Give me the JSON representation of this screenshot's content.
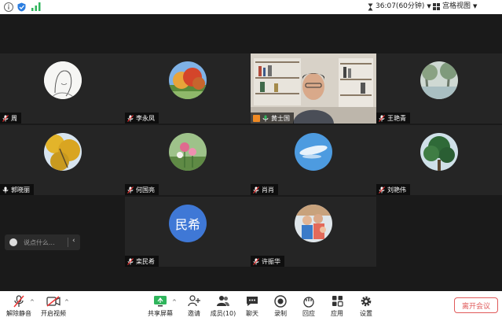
{
  "topbar": {
    "timer": "36:07(60分钟)",
    "view_label": "宫格视图"
  },
  "participants": [
    {
      "name": "周",
      "mic": "muted",
      "avatar": "sketch-portrait"
    },
    {
      "name": "李永凤",
      "mic": "muted",
      "avatar": "autumn-trees"
    },
    {
      "name": "黄士国",
      "mic": "on",
      "avatar": "video-feed",
      "active": true
    },
    {
      "name": "王艳青",
      "mic": "muted",
      "avatar": "lake-trees"
    },
    {
      "name": "郭晓丽",
      "mic": "on",
      "avatar": "ginkgo-leaves"
    },
    {
      "name": "何国亮",
      "mic": "muted",
      "avatar": "pink-flowers"
    },
    {
      "name": "肖肖",
      "mic": "muted",
      "avatar": "blue-sky"
    },
    {
      "name": "刘艳伟",
      "mic": "muted",
      "avatar": "green-tree"
    },
    {
      "name": "栾民希",
      "mic": "muted",
      "avatar": "initials",
      "initials": "民希"
    },
    {
      "name": "许振华",
      "mic": "muted",
      "avatar": "family-photo"
    }
  ],
  "chat": {
    "placeholder": "说点什么..."
  },
  "toolbar": {
    "unmute": "解除静音",
    "start_video": "开启视频",
    "share_screen": "共享屏幕",
    "invite": "邀请",
    "members": "成员(10)",
    "chat": "聊天",
    "record": "录制",
    "reactions": "回应",
    "apps": "应用",
    "settings": "设置",
    "end_meeting": "离开会议"
  },
  "colors": {
    "accent_green": "#2fb55c",
    "end_red": "#e05a5a",
    "avatar_blue": "#3f78d6"
  }
}
